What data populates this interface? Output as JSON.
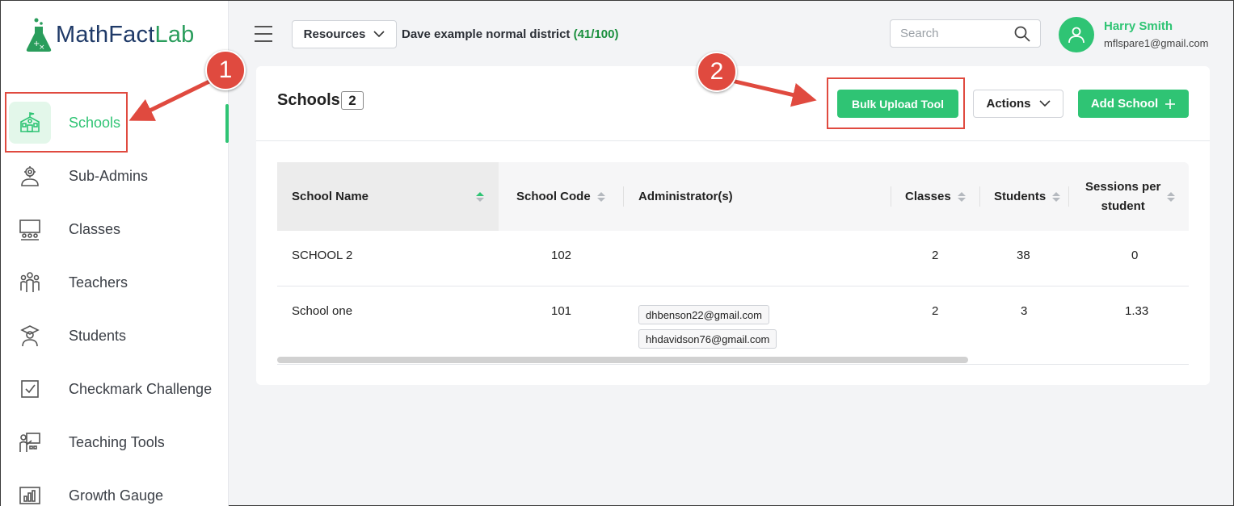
{
  "logo": {
    "part1": "MathFact",
    "part2": "Lab"
  },
  "sidebar": {
    "items": [
      {
        "label": "Schools",
        "icon": "school-icon",
        "active": true
      },
      {
        "label": "Sub-Admins",
        "icon": "admin-gear-icon"
      },
      {
        "label": "Classes",
        "icon": "classroom-icon"
      },
      {
        "label": "Teachers",
        "icon": "teachers-icon"
      },
      {
        "label": "Students",
        "icon": "student-icon"
      },
      {
        "label": "Checkmark Challenge",
        "icon": "checkbox-icon"
      },
      {
        "label": "Teaching Tools",
        "icon": "teaching-tools-icon"
      },
      {
        "label": "Growth Gauge",
        "icon": "growth-chart-icon"
      }
    ]
  },
  "topbar": {
    "resources_label": "Resources",
    "district_name": "Dave example normal district",
    "district_count": "(41/100)",
    "search_placeholder": "Search",
    "user_name": "Harry Smith",
    "user_email": "mflspare1@gmail.com"
  },
  "card": {
    "title": "Schools",
    "count": "2",
    "bulk_upload_label": "Bulk Upload Tool",
    "actions_label": "Actions",
    "add_school_label": "Add School"
  },
  "table": {
    "headers": {
      "school_name": "School Name",
      "school_code": "School Code",
      "administrators": "Administrator(s)",
      "classes": "Classes",
      "students": "Students",
      "sessions_line1": "Sessions per",
      "sessions_line2": "student"
    },
    "rows": [
      {
        "school_name": "SCHOOL 2",
        "school_code": "102",
        "administrators": [],
        "classes": "2",
        "students": "38",
        "sessions": "0"
      },
      {
        "school_name": "School one",
        "school_code": "101",
        "administrators": [
          "dhbenson22@gmail.com",
          "hhdavidson76@gmail.com"
        ],
        "classes": "2",
        "students": "3",
        "sessions": "1.33"
      }
    ]
  },
  "annotations": {
    "step1": "1",
    "step2": "2",
    "color": "#e04a3f"
  },
  "colors": {
    "accent": "#2fc474",
    "annotation": "#e04a3f",
    "brand_navy": "#1f3a68"
  }
}
